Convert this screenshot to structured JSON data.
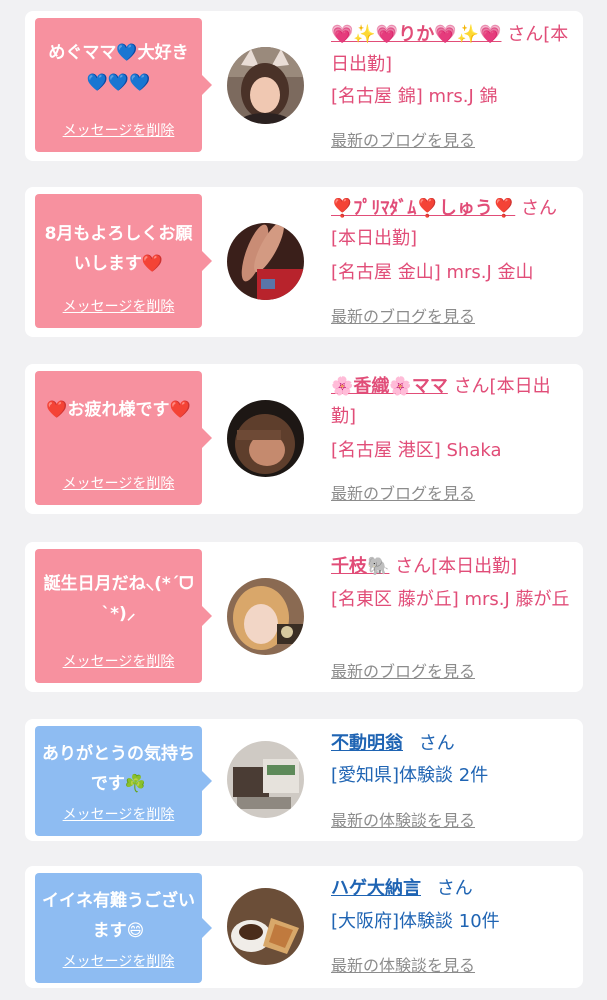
{
  "cards": [
    {
      "message": "めぐママ💙大好き💙💙💙",
      "delete_label": "メッセージを削除",
      "name": "💗✨💗りか💗✨💗",
      "suffix": "さん[本日出勤]",
      "detail": "[名古屋 錦] mrs.J 錦",
      "link": "最新のブログを見る",
      "avatar_icon": "photo-woman-cat-ears"
    },
    {
      "message": "8月もよろしくお願いします❤️",
      "delete_label": "メッセージを削除",
      "name": "❣️ﾌﾟﾘﾏﾀﾞﾑ❣️しゅう❣️",
      "suffix": "さん[本日出勤]",
      "detail": "[名古屋 金山] mrs.J 金山",
      "link": "最新のブログを見る",
      "avatar_icon": "photo-legs-red-dress"
    },
    {
      "message": "❤️お疲れ様です❤️",
      "delete_label": "メッセージを削除",
      "name": "🌸香織🌸ママ",
      "suffix": "さん[本日出勤]",
      "detail": "[名古屋 港区] Shaka",
      "link": "最新のブログを見る",
      "avatar_icon": "photo-woman-dark"
    },
    {
      "message": "誕生日月だね⸜(*ˊᗜˋ*)⸝",
      "delete_label": "メッセージを削除",
      "name": "千枝🐘",
      "suffix": "さん[本日出勤]",
      "detail": "[名東区 藤が丘] mrs.J 藤が丘",
      "link": "最新のブログを見る",
      "avatar_icon": "photo-woman-blonde"
    },
    {
      "message": "ありがとうの気持ちです☘️",
      "delete_label": "メッセージを削除",
      "name": "不動明翁",
      "suffix": "さん",
      "detail": "[愛知県]体験談 2件",
      "link": "最新の体験談を見る",
      "avatar_icon": "photo-shopping-items"
    },
    {
      "message": "イイネ有難うございます😄",
      "delete_label": "メッセージを削除",
      "name": "ハゲ大納言",
      "suffix": "さん",
      "detail": "[大阪府]体験談 10件",
      "link": "最新の体験談を見る",
      "avatar_icon": "photo-coffee-sandwich"
    }
  ],
  "colors": {
    "page_bg": "#f1f1f3",
    "bubble_pink": "#f7919f",
    "bubble_blue": "#8ebcf2",
    "name_pink": "#e14d78",
    "name_blue": "#1f64b3",
    "link_gray": "#8c8c8c"
  }
}
